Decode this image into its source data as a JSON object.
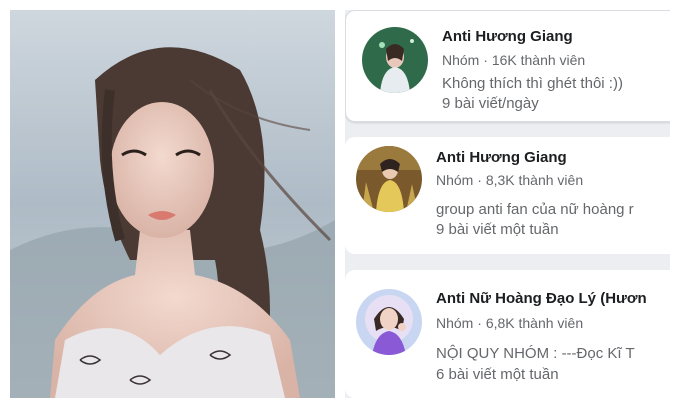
{
  "photo": {
    "alt": "portrait"
  },
  "groups": [
    {
      "name": "Anti Hương Giang",
      "type": "Nhóm",
      "members": "16K thành viên",
      "description": "Không thích thì ghét thôi :))",
      "activity": "9 bài viết/ngày"
    },
    {
      "name": "Anti Hương Giang",
      "type": "Nhóm",
      "members": "8,3K thành viên",
      "description": "group anti fan của nữ hoàng r",
      "activity": "9 bài viết một tuần"
    },
    {
      "name": "Anti Nữ Hoàng Đạo Lý (Hươn",
      "type": "Nhóm",
      "members": "6,8K thành viên",
      "description": "NỘI QUY NHÓM : ---Đọc Kĩ T",
      "activity": "6 bài viết một tuần"
    }
  ],
  "separator": "·",
  "colors": {
    "title": "#1c1e21",
    "secondary": "#65676b",
    "list_background": "#eceef1",
    "card": "#ffffff"
  }
}
